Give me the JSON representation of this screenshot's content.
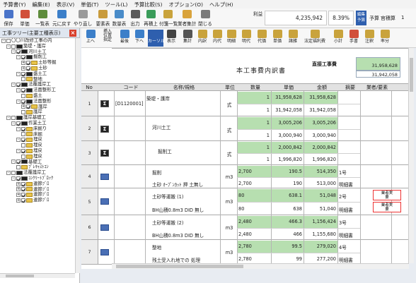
{
  "menu": [
    "予算書(Y)",
    "編集(E)",
    "表示(V)",
    "単価(T)",
    "ツール(L)",
    "予算比較(S)",
    "オプション(O)",
    "ヘルプ(H)"
  ],
  "toolbar1": {
    "buttons": [
      "保存",
      "単価",
      "一覧表",
      "元に戻す",
      "やり直し",
      "要素表",
      "数量表",
      "出力",
      "再積上",
      "付箋一覧",
      "業者集計",
      "閉じる"
    ],
    "summary_label": "利益",
    "summary_value": "4,235,942",
    "percent": "8.39%",
    "budget_label": "編集\n予算",
    "budget_text": "予算",
    "officer_label": "官積算",
    "officer_value": "1"
  },
  "toolbar2": {
    "buttons": [
      "上へ",
      "挿入\n位置\n指定",
      "最後",
      "下へ",
      "カーソル下",
      "表示",
      "集計",
      "内訳",
      "内代",
      "明細",
      "明代",
      "代価",
      "単価",
      "諸雑",
      "法定福利費",
      "小計",
      "手書",
      "注釈",
      "率分"
    ]
  },
  "tree": {
    "header": "工事ツリー(主要工種表示)",
    "nodes": [
      {
        "indent": 0,
        "pm": "-",
        "cb": false,
        "icon": "none",
        "label": "〇〇川改修工事の内"
      },
      {
        "indent": 1,
        "pm": "-",
        "cb": false,
        "icon": "sig",
        "label": "築堤・護岸"
      },
      {
        "indent": 2,
        "pm": "-",
        "cb": true,
        "icon": "sig",
        "label": "河川土工"
      },
      {
        "indent": 3,
        "pm": "-",
        "cb": true,
        "icon": "sig",
        "label": "掘削工"
      },
      {
        "indent": 4,
        "pm": "+",
        "cb": true,
        "icon": "fold",
        "label": "土砂等掘"
      },
      {
        "indent": 4,
        "pm": "+",
        "cb": true,
        "icon": "fold",
        "label": "土砂"
      },
      {
        "indent": 3,
        "pm": "-",
        "cb": true,
        "icon": "sig",
        "label": "盛土工"
      },
      {
        "indent": 4,
        "pm": "",
        "cb": false,
        "icon": "fold",
        "label": "整地"
      },
      {
        "indent": 2,
        "pm": "-",
        "cb": true,
        "icon": "sig",
        "label": "法覆護岸工"
      },
      {
        "indent": 3,
        "pm": "-",
        "cb": true,
        "icon": "sig",
        "label": "法面整形工"
      },
      {
        "indent": 4,
        "pm": "",
        "cb": false,
        "icon": "fold",
        "label": "盛土"
      },
      {
        "indent": 3,
        "pm": "-",
        "cb": true,
        "icon": "sig",
        "label": "法面整形"
      },
      {
        "indent": 4,
        "pm": "+",
        "cb": true,
        "icon": "fold",
        "label": "護岸"
      },
      {
        "indent": 4,
        "pm": "",
        "cb": false,
        "icon": "fold",
        "label": "護岸"
      },
      {
        "indent": 1,
        "pm": "-",
        "cb": false,
        "icon": "sig",
        "label": "護岸基礎工"
      },
      {
        "indent": 2,
        "pm": "-",
        "cb": true,
        "icon": "sig",
        "label": "作業土工"
      },
      {
        "indent": 3,
        "pm": "-",
        "cb": true,
        "icon": "fold",
        "label": "床掘り"
      },
      {
        "indent": 4,
        "pm": "",
        "cb": false,
        "icon": "fold",
        "label": "床掘"
      },
      {
        "indent": 3,
        "pm": "-",
        "cb": true,
        "icon": "fold",
        "label": "埋戻"
      },
      {
        "indent": 4,
        "pm": "",
        "cb": false,
        "icon": "fold",
        "label": "埋戻"
      },
      {
        "indent": 3,
        "pm": "-",
        "cb": true,
        "icon": "fold",
        "label": "埋戻"
      },
      {
        "indent": 4,
        "pm": "",
        "cb": false,
        "icon": "fold",
        "label": "埋戻"
      },
      {
        "indent": 2,
        "pm": "-",
        "cb": true,
        "icon": "sig",
        "label": "基礎工"
      },
      {
        "indent": 3,
        "pm": "",
        "cb": false,
        "icon": "fold",
        "label": "ﾌﾟﾚｷｬｽﾄｺﾝ"
      },
      {
        "indent": 1,
        "pm": "-",
        "cb": false,
        "icon": "sig",
        "label": "法覆護岸工"
      },
      {
        "indent": 2,
        "pm": "-",
        "cb": true,
        "icon": "sig",
        "label": "ｺﾝｸﾘｰﾄﾌﾞﾛｯｸ"
      },
      {
        "indent": 3,
        "pm": "+",
        "cb": true,
        "icon": "fold",
        "label": "連節ﾌﾞﾛ"
      },
      {
        "indent": 3,
        "pm": "+",
        "cb": true,
        "icon": "fold",
        "label": "連節ﾌﾞﾛ"
      },
      {
        "indent": 3,
        "pm": "+",
        "cb": true,
        "icon": "fold",
        "label": "連節ﾌﾞﾛ"
      },
      {
        "indent": 3,
        "pm": "+",
        "cb": true,
        "icon": "fold",
        "label": "連節ﾌﾞﾛ"
      }
    ]
  },
  "sheet": {
    "title": "本工事費内訳書",
    "direct_cost_label": "直接工事費",
    "direct_cost_green": "31,958,628",
    "direct_cost_white": "31,942,058",
    "columns": [
      "No",
      "コード",
      "名称/規格",
      "単位",
      "数量",
      "単価",
      "金額",
      "摘要",
      "業者/要素"
    ],
    "rows": [
      {
        "no": "1",
        "icon": "sig",
        "code": "[D1120001]",
        "name1": "築堤・護岸",
        "name2": "",
        "unit": "式",
        "q1": "1",
        "p1": "31,958,628",
        "a1": "31,958,628",
        "q2": "1",
        "p2": "31,942,058",
        "a2": "31,942,058",
        "memo1": "",
        "memo2": "",
        "badge": ""
      },
      {
        "no": "2",
        "icon": "sig",
        "code": "",
        "name1": "河川土工",
        "name2": "",
        "unit": "式",
        "q1": "1",
        "p1": "3,005,206",
        "a1": "3,005,206",
        "q2": "1",
        "p2": "3,000,940",
        "a2": "3,000,940",
        "memo1": "",
        "memo2": "",
        "badge": ""
      },
      {
        "no": "3",
        "icon": "sig",
        "code": "",
        "name1": "掘削工",
        "name2": "",
        "unit": "式",
        "q1": "1",
        "p1": "2,000,842",
        "a1": "2,000,842",
        "q2": "1",
        "p2": "1,996,820",
        "a2": "1,996,820",
        "memo1": "",
        "memo2": "",
        "badge": ""
      },
      {
        "no": "4",
        "icon": "h",
        "code": "",
        "name1": "掘削",
        "name2": "土砂 ｵｰﾌﾟﾝｶｯﾄ 押 土無し",
        "unit": "m3",
        "q1": "2,700",
        "p1": "190.5",
        "a1": "514,350",
        "q2": "2,700",
        "p2": "190",
        "a2": "513,000",
        "memo1": "1号",
        "memo2": "明細書",
        "badge": ""
      },
      {
        "no": "5",
        "icon": "h",
        "code": "",
        "name1": "土砂等運搬 (1)",
        "name2": "BH山積0.8m3 DID 無し",
        "unit": "m3",
        "q1": "80",
        "p1": "638.1",
        "a1": "51,048",
        "q2": "80",
        "p2": "638",
        "a2": "51,040",
        "memo1": "2号",
        "memo2": "明細書",
        "badge": "業者実\n要"
      },
      {
        "no": "6",
        "icon": "h",
        "code": "",
        "name1": "土砂等運搬 (2)",
        "name2": "BH山積0.8m3 DID 無し",
        "unit": "m3",
        "q1": "2,480",
        "p1": "466.3",
        "a1": "1,156,424",
        "q2": "2,480",
        "p2": "466",
        "a2": "1,155,680",
        "memo1": "3号",
        "memo2": "明細書",
        "badge": ""
      },
      {
        "no": "7",
        "icon": "h",
        "code": "",
        "name1": "整地",
        "name2": "残土受入れ地での 処理",
        "unit": "m3",
        "q1": "2,780",
        "p1": "99.5",
        "a1": "279,020",
        "q2": "2,780",
        "p2": "99",
        "a2": "277,200",
        "memo1": "4号",
        "memo2": "明細書",
        "badge": ""
      }
    ]
  }
}
